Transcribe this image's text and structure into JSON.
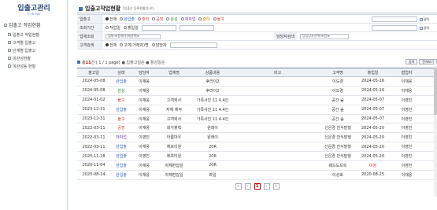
{
  "sidebar": {
    "title": "입출고관리",
    "subtitle": "in & out",
    "section": "입출고 작업현황",
    "items": [
      "입출고 작업현황",
      "고객별 입출고",
      "단계별 입출고",
      "미완성현황",
      "미완성등 현황"
    ]
  },
  "header": {
    "title": "입출고작업현황",
    "desc": "[입출고 등록현황입니다."
  },
  "filters": {
    "status": {
      "label": "입출고",
      "options": [
        "전체",
        "완입출",
        "출력",
        "공장",
        "완성",
        "재작업",
        "출하",
        "불고"
      ],
      "colors": [
        "#333",
        "#2a5bd7",
        "#d43b3b",
        "#d43b3b",
        "#2a8a2a",
        "#7a3fb0",
        "#e08a00",
        "#d43b3b"
      ]
    },
    "date": {
      "label": "조회기간",
      "options": [
        "작업일",
        "출입일"
      ],
      "cal": "달력"
    },
    "company": {
      "label": "업체조회",
      "select": "업체-포함체가(제선택)▾",
      "assignee_label": "담당자검색",
      "assignee_select": "당담당자선택(포함)▾"
    },
    "customer": {
      "label": "고객검색",
      "options": [
        "전체",
        "고객(거래처)명",
        "담당자"
      ]
    }
  },
  "summary": {
    "prefix": "총",
    "count": "11",
    "suffix": "건 ( 1 / 1 page)",
    "legend": "● 입출고일순 ● 활성일순"
  },
  "buttons": {
    "search": "검색",
    "view_all": "전체보기"
  },
  "columns": [
    "출고일",
    "상태",
    "담당자",
    "업체명",
    "상품내용",
    "비고",
    "고객명",
    "출입일",
    "협업자",
    ""
  ],
  "rows": [
    {
      "date": "2024-05-08",
      "status": "완입출",
      "st_color": "#2a5bd7",
      "user": "이재웅",
      "co": "",
      "prod": "후라이2",
      "note": "",
      "cust": "이도경",
      "d2": "2024-05-16",
      "d2_color": "#333",
      "coll": "이재웅"
    },
    {
      "date": "2024-05-08",
      "status": "완성",
      "st_color": "#2a8a2a",
      "user": "이재웅",
      "co": "",
      "prod": "후라이2",
      "note": "",
      "cust": "이도경",
      "d2": "2024-05-16",
      "d2_color": "#333",
      "coll": "이재웅"
    },
    {
      "date": "2024-01-02",
      "status": "불고",
      "st_color": "#d43b3b",
      "user": "이재웅",
      "co": "고객회사",
      "prod": "가족사진 11 4.4인",
      "note": "",
      "cust": "공간 숲",
      "d2": "2024-05-07",
      "d2_color": "#333",
      "coll": "이영진"
    },
    {
      "date": "2023-12-31",
      "status": "완입출",
      "st_color": "#2a5bd7",
      "user": "이재웅",
      "co": "자체 제작",
      "prod": "가족사진 11 4.4인",
      "note": "",
      "cust": "공간 숲",
      "d2": "2024-05-07",
      "d2_color": "#333",
      "coll": "이영진"
    },
    {
      "date": "2023-12-31",
      "status": "불고",
      "st_color": "#d43b3b",
      "user": "이재웅",
      "co": "고객회사",
      "prod": "가족사진 11 4.4인",
      "note": "",
      "cust": "공간 숲",
      "d2": "2024-05-07",
      "d2_color": "#333",
      "coll": "이영진"
    },
    {
      "date": "2022-03-11",
      "status": "공장",
      "st_color": "#d43b3b",
      "user": "이재웅",
      "co": "회가출력",
      "prod": "원래이",
      "note": "",
      "cust": "신은경 안식발행",
      "d2": "2024-05-20",
      "d2_color": "#333",
      "coll": "이영진"
    },
    {
      "date": "2022-03-11",
      "status": "재작업",
      "st_color": "#7a3fb0",
      "user": "이영진",
      "co": "아름마우",
      "prod": "원래이",
      "note": "",
      "cust": "신은경 안식발행",
      "d2": "2024-05-20",
      "d2_color": "#333",
      "coll": "이영진"
    },
    {
      "date": "2022-03-11",
      "status": "완입출",
      "st_color": "#2a5bd7",
      "user": "이재웅",
      "co": "에프티원",
      "prod": "20R",
      "note": "",
      "cust": "신은경 안식발행",
      "d2": "2024-05-20",
      "d2_color": "#333",
      "coll": "이영진"
    },
    {
      "date": "2020-11-18",
      "status": "완입출",
      "st_color": "#2a5bd7",
      "user": "이영진",
      "co": "에프티원",
      "prod": "20R",
      "note": "",
      "cust": "신은경 안식발행",
      "d2": "2024-05-20",
      "d2_color": "#333",
      "coll": "이영진"
    },
    {
      "date": "2020-11-04",
      "status": "완입출",
      "st_color": "#2a5bd7",
      "user": "이재웅",
      "co": "자체편집일",
      "prod": "20R",
      "note": "",
      "cust": "웨드도프트",
      "d2": "미정",
      "d2_color": "#d43b3b",
      "coll": "이영진"
    },
    {
      "date": "2020-08-24",
      "status": "완입출",
      "st_color": "#2a5bd7",
      "user": "이재웅",
      "co": "자체편집일",
      "prod": "파일",
      "note": "",
      "cust": "이성호",
      "d2": "2020-08-25",
      "d2_color": "#333",
      "coll": "이재웅"
    }
  ],
  "pager": {
    "prev2": "«",
    "prev": "‹",
    "current": "1",
    "next": "›",
    "next2": "»"
  }
}
